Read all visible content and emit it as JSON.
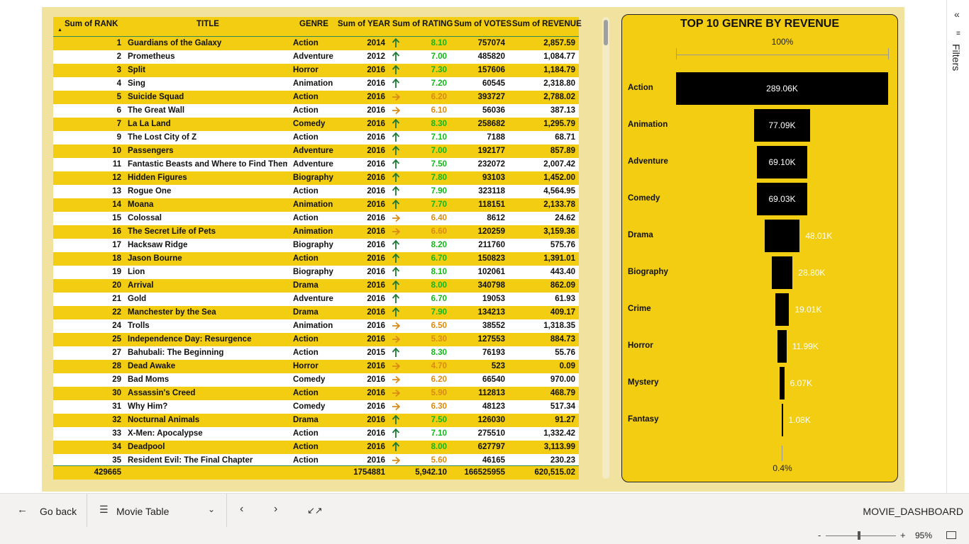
{
  "table": {
    "headers": {
      "rank": "Sum of RANK",
      "title": "TITLE",
      "genre": "GENRE",
      "year": "Sum of YEAR",
      "rating": "Sum of RATING",
      "votes": "Sum of VOTES",
      "revenue": "Sum of REVENUE"
    },
    "rows": [
      {
        "rank": "1",
        "title": "Guardians of the Galaxy",
        "genre": "Action",
        "year": "2014",
        "trend": "up",
        "rating": "8.10",
        "votes": "757074",
        "revenue": "2,857.59"
      },
      {
        "rank": "2",
        "title": "Prometheus",
        "genre": "Adventure",
        "year": "2012",
        "trend": "up",
        "rating": "7.00",
        "votes": "485820",
        "revenue": "1,084.77"
      },
      {
        "rank": "3",
        "title": "Split",
        "genre": "Horror",
        "year": "2016",
        "trend": "up",
        "rating": "7.30",
        "votes": "157606",
        "revenue": "1,184.79"
      },
      {
        "rank": "4",
        "title": "Sing",
        "genre": "Animation",
        "year": "2016",
        "trend": "up",
        "rating": "7.20",
        "votes": "60545",
        "revenue": "2,318.80"
      },
      {
        "rank": "5",
        "title": "Suicide Squad",
        "genre": "Action",
        "year": "2016",
        "trend": "right",
        "rating": "6.20",
        "votes": "393727",
        "revenue": "2,788.02"
      },
      {
        "rank": "6",
        "title": "The Great Wall",
        "genre": "Action",
        "year": "2016",
        "trend": "right",
        "rating": "6.10",
        "votes": "56036",
        "revenue": "387.13"
      },
      {
        "rank": "7",
        "title": "La La Land",
        "genre": "Comedy",
        "year": "2016",
        "trend": "up",
        "rating": "8.30",
        "votes": "258682",
        "revenue": "1,295.79"
      },
      {
        "rank": "9",
        "title": "The Lost City of Z",
        "genre": "Action",
        "year": "2016",
        "trend": "up",
        "rating": "7.10",
        "votes": "7188",
        "revenue": "68.71"
      },
      {
        "rank": "10",
        "title": "Passengers",
        "genre": "Adventure",
        "year": "2016",
        "trend": "up",
        "rating": "7.00",
        "votes": "192177",
        "revenue": "857.89"
      },
      {
        "rank": "11",
        "title": "Fantastic Beasts and Where to Find Them",
        "genre": "Adventure",
        "year": "2016",
        "trend": "up",
        "rating": "7.50",
        "votes": "232072",
        "revenue": "2,007.42"
      },
      {
        "rank": "12",
        "title": "Hidden Figures",
        "genre": "Biography",
        "year": "2016",
        "trend": "up",
        "rating": "7.80",
        "votes": "93103",
        "revenue": "1,452.00"
      },
      {
        "rank": "13",
        "title": "Rogue One",
        "genre": "Action",
        "year": "2016",
        "trend": "up",
        "rating": "7.90",
        "votes": "323118",
        "revenue": "4,564.95"
      },
      {
        "rank": "14",
        "title": "Moana",
        "genre": "Animation",
        "year": "2016",
        "trend": "up",
        "rating": "7.70",
        "votes": "118151",
        "revenue": "2,133.78"
      },
      {
        "rank": "15",
        "title": "Colossal",
        "genre": "Action",
        "year": "2016",
        "trend": "right",
        "rating": "6.40",
        "votes": "8612",
        "revenue": "24.62"
      },
      {
        "rank": "16",
        "title": "The Secret Life of Pets",
        "genre": "Animation",
        "year": "2016",
        "trend": "right",
        "rating": "6.60",
        "votes": "120259",
        "revenue": "3,159.36"
      },
      {
        "rank": "17",
        "title": "Hacksaw Ridge",
        "genre": "Biography",
        "year": "2016",
        "trend": "up",
        "rating": "8.20",
        "votes": "211760",
        "revenue": "575.76"
      },
      {
        "rank": "18",
        "title": "Jason Bourne",
        "genre": "Action",
        "year": "2016",
        "trend": "up",
        "rating": "6.70",
        "votes": "150823",
        "revenue": "1,391.01"
      },
      {
        "rank": "19",
        "title": "Lion",
        "genre": "Biography",
        "year": "2016",
        "trend": "up",
        "rating": "8.10",
        "votes": "102061",
        "revenue": "443.40"
      },
      {
        "rank": "20",
        "title": "Arrival",
        "genre": "Drama",
        "year": "2016",
        "trend": "up",
        "rating": "8.00",
        "votes": "340798",
        "revenue": "862.09"
      },
      {
        "rank": "21",
        "title": "Gold",
        "genre": "Adventure",
        "year": "2016",
        "trend": "up",
        "rating": "6.70",
        "votes": "19053",
        "revenue": "61.93"
      },
      {
        "rank": "22",
        "title": "Manchester by the Sea",
        "genre": "Drama",
        "year": "2016",
        "trend": "up",
        "rating": "7.90",
        "votes": "134213",
        "revenue": "409.17"
      },
      {
        "rank": "24",
        "title": "Trolls",
        "genre": "Animation",
        "year": "2016",
        "trend": "right",
        "rating": "6.50",
        "votes": "38552",
        "revenue": "1,318.35"
      },
      {
        "rank": "25",
        "title": "Independence Day: Resurgence",
        "genre": "Action",
        "year": "2016",
        "trend": "right",
        "rating": "5.30",
        "votes": "127553",
        "revenue": "884.73"
      },
      {
        "rank": "27",
        "title": "Bahubali: The Beginning",
        "genre": "Action",
        "year": "2015",
        "trend": "up",
        "rating": "8.30",
        "votes": "76193",
        "revenue": "55.76"
      },
      {
        "rank": "28",
        "title": "Dead Awake",
        "genre": "Horror",
        "year": "2016",
        "trend": "right",
        "rating": "4.70",
        "votes": "523",
        "revenue": "0.09"
      },
      {
        "rank": "29",
        "title": "Bad Moms",
        "genre": "Comedy",
        "year": "2016",
        "trend": "right",
        "rating": "6.20",
        "votes": "66540",
        "revenue": "970.00"
      },
      {
        "rank": "30",
        "title": "Assassin's Creed",
        "genre": "Action",
        "year": "2016",
        "trend": "right",
        "rating": "5.90",
        "votes": "112813",
        "revenue": "468.79"
      },
      {
        "rank": "31",
        "title": "Why Him?",
        "genre": "Comedy",
        "year": "2016",
        "trend": "right",
        "rating": "6.30",
        "votes": "48123",
        "revenue": "517.34"
      },
      {
        "rank": "32",
        "title": "Nocturnal Animals",
        "genre": "Drama",
        "year": "2016",
        "trend": "up",
        "rating": "7.50",
        "votes": "126030",
        "revenue": "91.27"
      },
      {
        "rank": "33",
        "title": "X-Men: Apocalypse",
        "genre": "Action",
        "year": "2016",
        "trend": "up",
        "rating": "7.10",
        "votes": "275510",
        "revenue": "1,332.42"
      },
      {
        "rank": "34",
        "title": "Deadpool",
        "genre": "Action",
        "year": "2016",
        "trend": "up",
        "rating": "8.00",
        "votes": "627797",
        "revenue": "3,113.99"
      },
      {
        "rank": "35",
        "title": "Resident Evil: The Final Chapter",
        "genre": "Action",
        "year": "2016",
        "trend": "right",
        "rating": "5.60",
        "votes": "46165",
        "revenue": "230.23"
      }
    ],
    "totals": {
      "rank": "429665",
      "year": "1754881",
      "rating": "5,942.10",
      "votes": "166525955",
      "revenue": "620,515.02"
    },
    "colors": {
      "band": "#f2cd11",
      "good": "#18b41e",
      "mid": "#d98c15",
      "up_icon": "#1e7a34",
      "right_icon": "#d98c15"
    }
  },
  "funnel": {
    "title": "TOP 10 GENRE BY REVENUE",
    "top_pct": "100%",
    "bottom_pct": "0.4%",
    "chart_data": {
      "type": "funnel",
      "title": "TOP 10 GENRE BY REVENUE",
      "categories": [
        "Action",
        "Animation",
        "Adventure",
        "Comedy",
        "Drama",
        "Biography",
        "Crime",
        "Horror",
        "Mystery",
        "Fantasy"
      ],
      "values": [
        289.06,
        77.09,
        69.1,
        69.03,
        48.01,
        28.8,
        19.01,
        11.99,
        6.07,
        1.08
      ],
      "value_labels": [
        "289.06K",
        "77.09K",
        "69.10K",
        "69.03K",
        "48.01K",
        "28.80K",
        "19.01K",
        "11.99K",
        "6.07K",
        "1.08K"
      ],
      "unit": "K"
    }
  },
  "filters": {
    "label": "Filters"
  },
  "bottom_bar": {
    "go_back": "Go back",
    "page_name": "Movie Table",
    "report_name": "MOVIE_DASHBOARD"
  },
  "status_bar": {
    "zoom": "95%",
    "zoom_level": 0.95
  }
}
